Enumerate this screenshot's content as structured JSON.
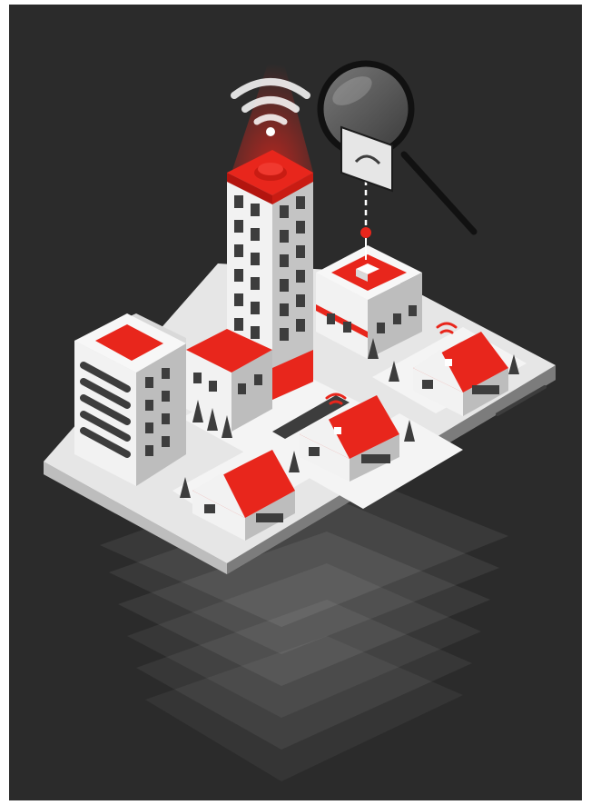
{
  "illustration": {
    "subject": "",
    "icons": [
      "wifi-icon",
      "magnifying-glass-icon",
      "location-pin-icon"
    ],
    "colors": {
      "background": "#2b2b2b",
      "accent": "#e8261c",
      "accent_dark": "#b3150f",
      "white": "#f2f2f2",
      "light_gray": "#d9d9d9",
      "mid_gray": "#9a9a9a",
      "dark_gray": "#3d3d3d",
      "window": "#4a4a4a"
    }
  }
}
